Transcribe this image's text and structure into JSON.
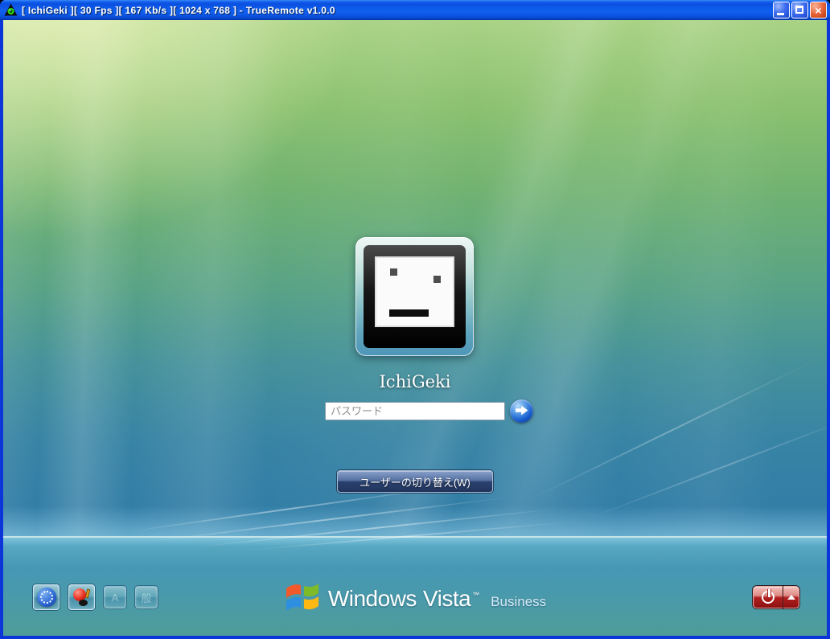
{
  "window": {
    "title": "[ IchiGeki ][ 30 Fps ][ 167 Kb/s ][ 1024 x 768 ] - TrueRemote v1.0.0",
    "controls": {
      "close_glyph": "×"
    }
  },
  "login": {
    "username": "IchiGeki",
    "password_placeholder": "パスワード",
    "switch_user_button": "ユーザーの切り替え(W)"
  },
  "ime_bar": {
    "input_mode_label": "A",
    "conversion_mode_label": "般"
  },
  "branding": {
    "brand": "Windows",
    "product": "Vista",
    "trademark": "™",
    "edition": "Business"
  },
  "colors": {
    "titlebar_blue": "#0d56e6",
    "window_border_blue": "#0c36da",
    "close_button_red": "#d44a1e",
    "power_button_red": "#a81616",
    "go_button_blue": "#1a5fd0",
    "switch_button_blue": "#2b416e",
    "aurora_green_top": "#a9d284",
    "aurora_blue_bottom": "#4697b4"
  }
}
